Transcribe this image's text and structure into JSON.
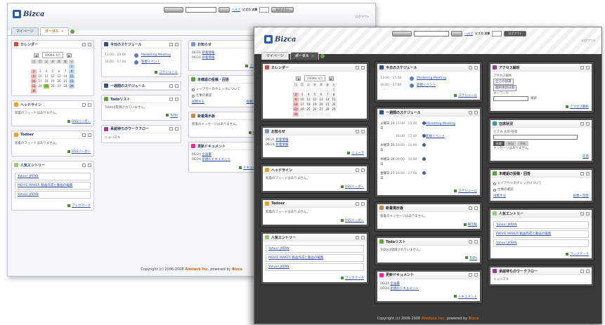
{
  "app_name": "Bizca",
  "copyright": "Copyright (c) 2006-2008",
  "company": "Aimluck Inc.",
  "powered_by": "powered by",
  "powered_brand": "Bizca",
  "toolbar": {
    "search_placeholder": "",
    "help_link": "ヘルプ",
    "user_name": "ビズカ 太郎",
    "logout": "ログアウト"
  },
  "tabs": {
    "my_page": "マイページ",
    "portal": "ポータル"
  },
  "calendar": {
    "title": "カレンダー",
    "month": "2008年 6月",
    "weekdays": [
      "日",
      "月",
      "火",
      "水",
      "木",
      "金",
      "土"
    ],
    "days": [
      "",
      "",
      "",
      "",
      "",
      "",
      "1",
      "2",
      "3",
      "4",
      "5",
      "6",
      "7",
      "8",
      "9",
      "10",
      "11",
      "12",
      "13",
      "14",
      "15",
      "16",
      "17",
      "18",
      "19",
      "20",
      "21",
      "22",
      "23",
      "24",
      "25",
      "26",
      "27",
      "28",
      "29",
      "30",
      "",
      "",
      "",
      "",
      ""
    ],
    "today": "25"
  },
  "schedule": {
    "title": "今日のスケジュール",
    "events": [
      {
        "time": "13:00 - 15:00",
        "name": "Marketing Meeting"
      },
      {
        "time": "16:00 - 17:00",
        "name": "新規イベント"
      }
    ],
    "footer": "スケジュール"
  },
  "weekly": {
    "title": "一週間のスケジュール",
    "rows": [
      {
        "day": "火曜日 24日",
        "time": "13:00 - 15:00"
      },
      {
        "day": "",
        "time": "16:00 - 17:00"
      },
      {
        "day": "水曜日 25日",
        "time": "10:00 - 11:00"
      },
      {
        "day": "木曜日 26日",
        "time": "09:00 - 10:00"
      },
      {
        "day": "金曜日 27日",
        "time": "16:00 - 17:00"
      }
    ],
    "footer": "スケジュール"
  },
  "notices": {
    "title": "お知らせ",
    "items": [
      {
        "date": "06/21",
        "text": "新着情報"
      },
      {
        "date": "06/21",
        "text": "新着情報"
      }
    ],
    "footer": "ニュース"
  },
  "headline": {
    "title": "ヘッドライン",
    "text": "新着のフィードはありません。",
    "footer": "RSSリーダー"
  },
  "todo": {
    "title": "Todoリスト",
    "text": "ToDoは登録されていません。",
    "footer": "ToDo"
  },
  "board": {
    "title": "新着掲示板",
    "text": "新着のメッセージはありません。",
    "footer": "掲示板"
  },
  "popular": {
    "title": "人気エントリー",
    "items": [
      "Yahoo! JAPAN",
      "MOVIE MAKER 動画作成と動画の編集",
      "Yahoo! JAPAN"
    ],
    "footer": "ブックマーク"
  },
  "access": {
    "title": "アクセス解析",
    "label1": "アクセス解析",
    "sel1": "全ての部署",
    "sel2": "最終更新日順",
    "label2": "キーワード",
    "search_btn": "検索",
    "footer": "アクセス解析"
  },
  "org": {
    "title": "在席状況",
    "name": "ビズカ 太郎",
    "status": "在席",
    "tabs": [
      "在席",
      "外出",
      "不在"
    ],
    "text": "メッセージはありません。",
    "footer": "在席"
  },
  "survey": {
    "title": "未確認の投稿・回答",
    "items": [
      "レイアウトのチェックについて",
      "仕事の確認"
    ],
    "left_footer": "投稿する",
    "footer": "投稿・回答"
  },
  "docs": {
    "title": "更新ドキュメント",
    "items": [
      {
        "date": "06/24",
        "text": "企画書"
      },
      {
        "date": "06/24",
        "text": "新規のドキュメント"
      }
    ],
    "footer": "ドキュメント"
  },
  "workflow": {
    "title": "承認待ちのワークフロー",
    "text": "ニュースキ"
  }
}
